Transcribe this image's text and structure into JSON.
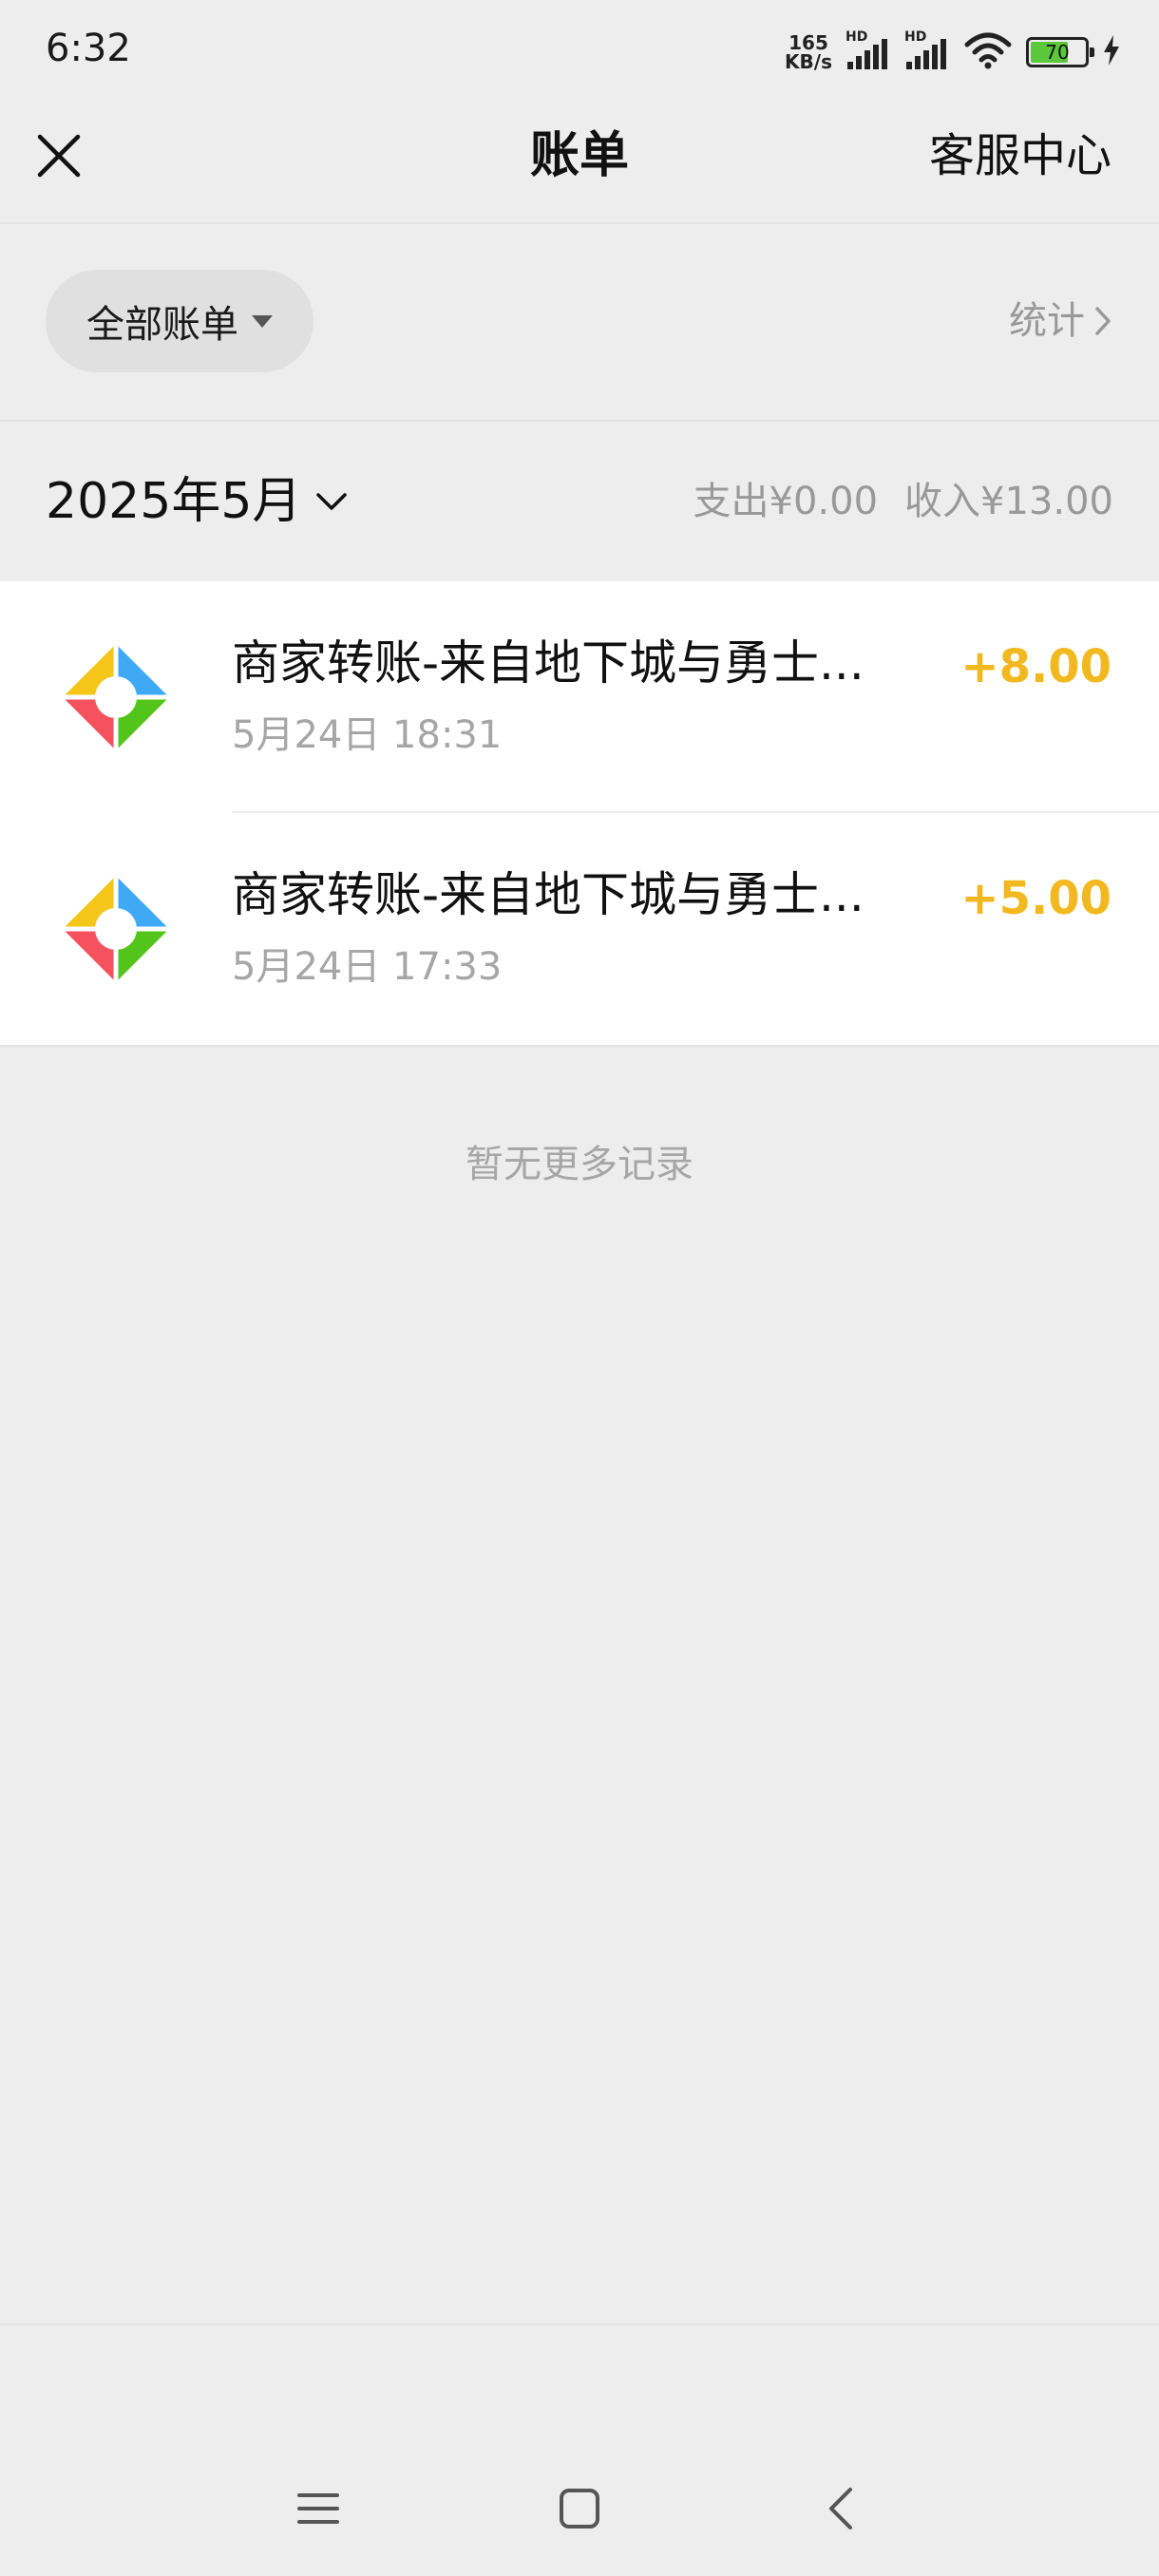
{
  "status_bar": {
    "time": "6:32",
    "net_speed_value": "165",
    "net_speed_unit": "KB/s",
    "hd_label": "HD",
    "battery_level": "70",
    "icons": [
      "signal-icon",
      "wifi-icon",
      "battery-icon",
      "charging-icon"
    ]
  },
  "header": {
    "title": "账单",
    "service_link": "客服中心",
    "close_icon": "close-icon"
  },
  "filter": {
    "label": "全部账单",
    "stats_label": "统计"
  },
  "month": {
    "label": "2025年5月",
    "expense": "支出¥0.00",
    "income": "收入¥13.00"
  },
  "transactions": [
    {
      "title": "商家转账-来自地下城与勇士...",
      "time": "5月24日 18:31",
      "amount": "+8.00"
    },
    {
      "title": "商家转账-来自地下城与勇士...",
      "time": "5月24日 17:33",
      "amount": "+5.00"
    }
  ],
  "footer": {
    "no_more": "暂无更多记录"
  },
  "nav": {
    "icons": [
      "menu-icon",
      "home-icon",
      "back-icon"
    ]
  },
  "colors": {
    "background": "#ededed",
    "card": "#ffffff",
    "amount": "#f2b81f",
    "muted_text": "#999999"
  }
}
